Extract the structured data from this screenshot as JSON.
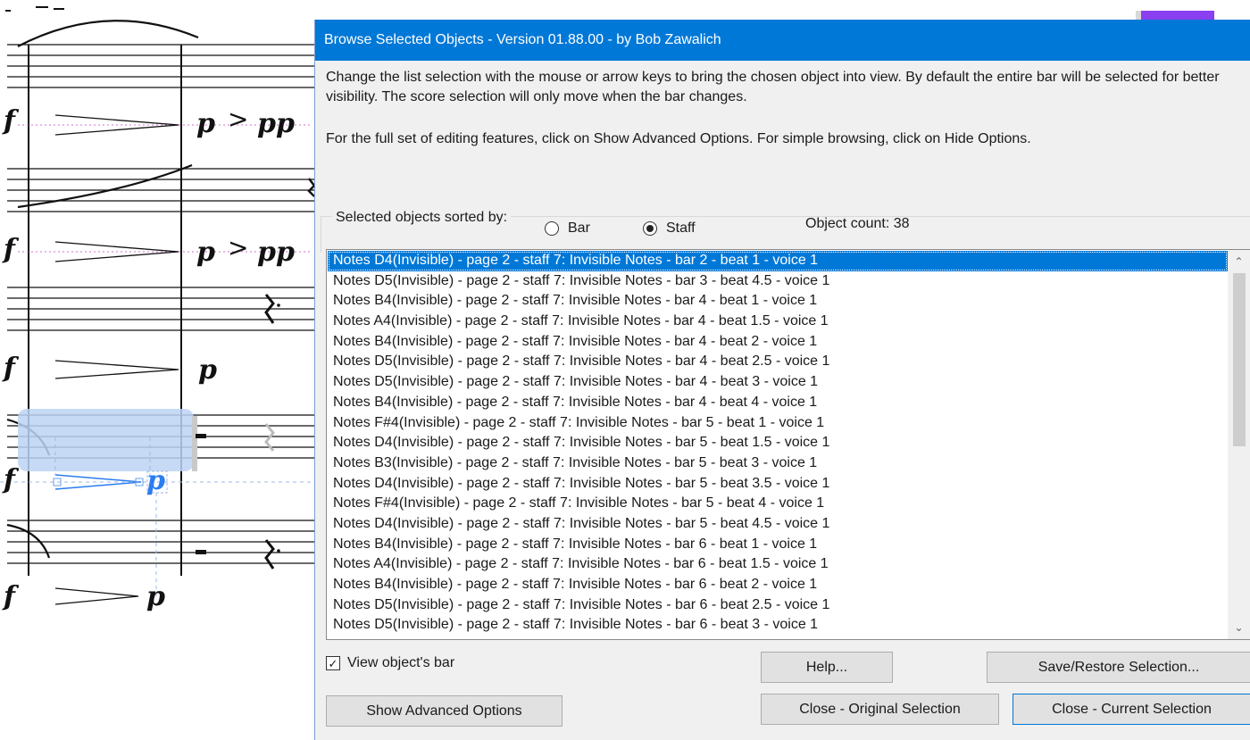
{
  "score": {
    "dynamics": {
      "f": "f",
      "p": "p",
      "accent": ">",
      "pp": "pp"
    }
  },
  "dialog": {
    "title": "Browse Selected Objects - Version 01.88.00 - by Bob Zawalich",
    "description_1": "Change the list selection with the mouse or arrow keys to bring the  chosen object into view. By default the entire bar will be selected for better visibility. The score selection will only move when the bar changes.",
    "description_2": "For the full set of editing features, click on Show Advanced Options. For simple browsing, click on Hide Options.",
    "sort": {
      "label": "Selected objects sorted by:",
      "options": [
        {
          "label": "Bar",
          "selected": false
        },
        {
          "label": "Staff",
          "selected": true
        }
      ]
    },
    "object_count": "Object count: 38",
    "list": {
      "selected_index": 0,
      "items": [
        "Notes D4(Invisible) - page 2 - staff 7: Invisible Notes - bar 2 - beat 1 - voice 1",
        "Notes D5(Invisible) - page 2 - staff 7: Invisible Notes - bar 3 - beat 4.5 - voice 1",
        "Notes B4(Invisible) - page 2 - staff 7: Invisible Notes - bar 4 - beat 1 - voice 1",
        "Notes A4(Invisible) - page 2 - staff 7: Invisible Notes - bar 4 - beat 1.5 - voice 1",
        "Notes B4(Invisible) - page 2 - staff 7: Invisible Notes - bar 4 - beat 2 - voice 1",
        "Notes D5(Invisible) - page 2 - staff 7: Invisible Notes - bar 4 - beat 2.5 - voice 1",
        "Notes D5(Invisible) - page 2 - staff 7: Invisible Notes - bar 4 - beat 3 - voice 1",
        "Notes B4(Invisible) - page 2 - staff 7: Invisible Notes - bar 4 - beat 4 - voice 1",
        "Notes F#4(Invisible) - page 2 - staff 7: Invisible Notes - bar 5 - beat 1 - voice 1",
        "Notes D4(Invisible) - page 2 - staff 7: Invisible Notes - bar 5 - beat 1.5 - voice 1",
        "Notes B3(Invisible) - page 2 - staff 7: Invisible Notes - bar 5 - beat 3 - voice 1",
        "Notes D4(Invisible) - page 2 - staff 7: Invisible Notes - bar 5 - beat 3.5 - voice 1",
        "Notes F#4(Invisible) - page 2 - staff 7: Invisible Notes - bar 5 - beat 4 - voice 1",
        "Notes D4(Invisible) - page 2 - staff 7: Invisible Notes - bar 5 - beat 4.5 - voice 1",
        "Notes B4(Invisible) - page 2 - staff 7: Invisible Notes - bar 6 - beat 1 - voice 1",
        "Notes A4(Invisible) - page 2 - staff 7: Invisible Notes - bar 6 - beat 1.5 - voice 1",
        "Notes B4(Invisible) - page 2 - staff 7: Invisible Notes - bar 6 - beat 2 - voice 1",
        "Notes D5(Invisible) - page 2 - staff 7: Invisible Notes - bar 6 - beat 2.5 - voice 1",
        "Notes D5(Invisible) - page 2 - staff 7: Invisible Notes - bar 6 - beat 3 - voice 1"
      ]
    },
    "view_bar": {
      "label": "View object's bar",
      "checked": true,
      "check_glyph": "✓"
    },
    "buttons": {
      "help": "Help...",
      "save_restore": "Save/Restore Selection...",
      "show_advanced": "Show Advanced Options",
      "close_original": "Close - Original Selection",
      "close_current": "Close - Current Selection"
    },
    "scroll": {
      "up_glyph": "⌃",
      "down_glyph": "⌄"
    },
    "colors": {
      "titlebar": "#0078d7",
      "selection": "#0078d7",
      "score_selection": "#2a7df0"
    }
  }
}
